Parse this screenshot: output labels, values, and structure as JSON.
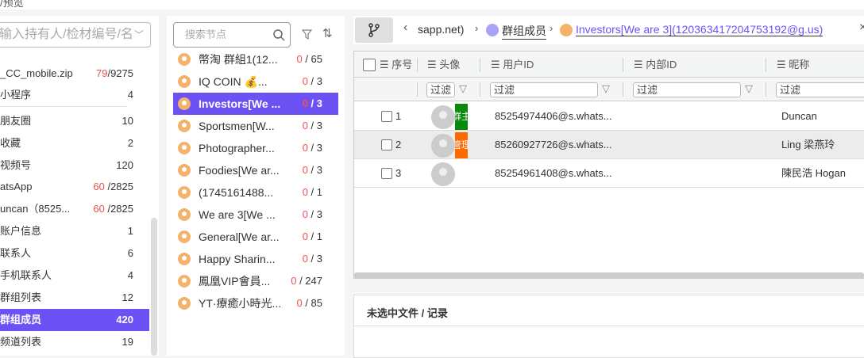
{
  "top_title": "/预览",
  "left": {
    "search_placeholder": "输入持有人/检材编号/名",
    "items": [
      {
        "label": "_CC_mobile.zip",
        "red": "79",
        "count": "/9275"
      },
      {
        "label": "小程序",
        "count": "4"
      },
      {
        "label": "朋友圈",
        "count": "10"
      },
      {
        "label": "收藏",
        "count": "2"
      },
      {
        "label": "视频号",
        "count": "120"
      },
      {
        "label": "atsApp",
        "red": "60",
        "count": " /2825"
      },
      {
        "label": "uncan（8525...",
        "red": "60",
        "count": " /2825"
      },
      {
        "label": "账户信息",
        "count": "1"
      },
      {
        "label": "联系人",
        "count": "6"
      },
      {
        "label": "手机联系人",
        "count": "4"
      },
      {
        "label": "群组列表",
        "count": "12"
      },
      {
        "label": "群组成员",
        "count": "420"
      },
      {
        "label": "频道列表",
        "count": "19"
      }
    ]
  },
  "middle": {
    "search_placeholder": "搜索节点",
    "items": [
      {
        "name": "幣淘 群組1(12...",
        "red": "0",
        "total": " / 65"
      },
      {
        "name": "IQ COIN 💰...",
        "red": "0",
        "total": " / 3"
      },
      {
        "name": "Investors[We ...",
        "red": "0",
        "total": " / 3"
      },
      {
        "name": "Sportsmen[W...",
        "red": "0",
        "total": " / 3"
      },
      {
        "name": "Photographer...",
        "red": "0",
        "total": " / 3"
      },
      {
        "name": "Foodies[We ar...",
        "red": "0",
        "total": " / 3"
      },
      {
        "name": "(1745161488...",
        "red": "0",
        "total": " / 1"
      },
      {
        "name": "We are 3[We ...",
        "red": "0",
        "total": " / 3"
      },
      {
        "name": "General[We ar...",
        "red": "0",
        "total": " / 1"
      },
      {
        "name": "Happy Sharin...",
        "red": "0",
        "total": " / 3"
      },
      {
        "name": "鳳凰VIP會員...",
        "red": "0",
        "total": " / 247"
      },
      {
        "name": "YT·療癒小時光...",
        "red": "0",
        "total": " / 85"
      }
    ]
  },
  "breadcrumb": {
    "back": "‹",
    "part1": "sapp.net)",
    "part2": "群组成员",
    "part3": "Investors[We are 3](120363417204753192@g.us)",
    "close": "×"
  },
  "table": {
    "headers": [
      "序号",
      "头像",
      "用户ID",
      "内部ID",
      "昵称"
    ],
    "filter_placeholder": "过滤",
    "rows": [
      {
        "idx": "1",
        "tag": "群主",
        "tag_color": "#0a8a0a",
        "user_id": "85254974406@s.whats...",
        "internal_id": "",
        "nickname": "Duncan"
      },
      {
        "idx": "2",
        "tag": "管理",
        "tag_color": "#ff6a00",
        "user_id": "85260927726@s.whats...",
        "internal_id": "",
        "nickname": "Ling 梁燕玲"
      },
      {
        "idx": "3",
        "tag": "",
        "user_id": "85254961408@s.whats...",
        "internal_id": "",
        "nickname": "陳民浩 Hogan"
      }
    ]
  },
  "detail": {
    "title": "未选中文件 / 记录"
  }
}
